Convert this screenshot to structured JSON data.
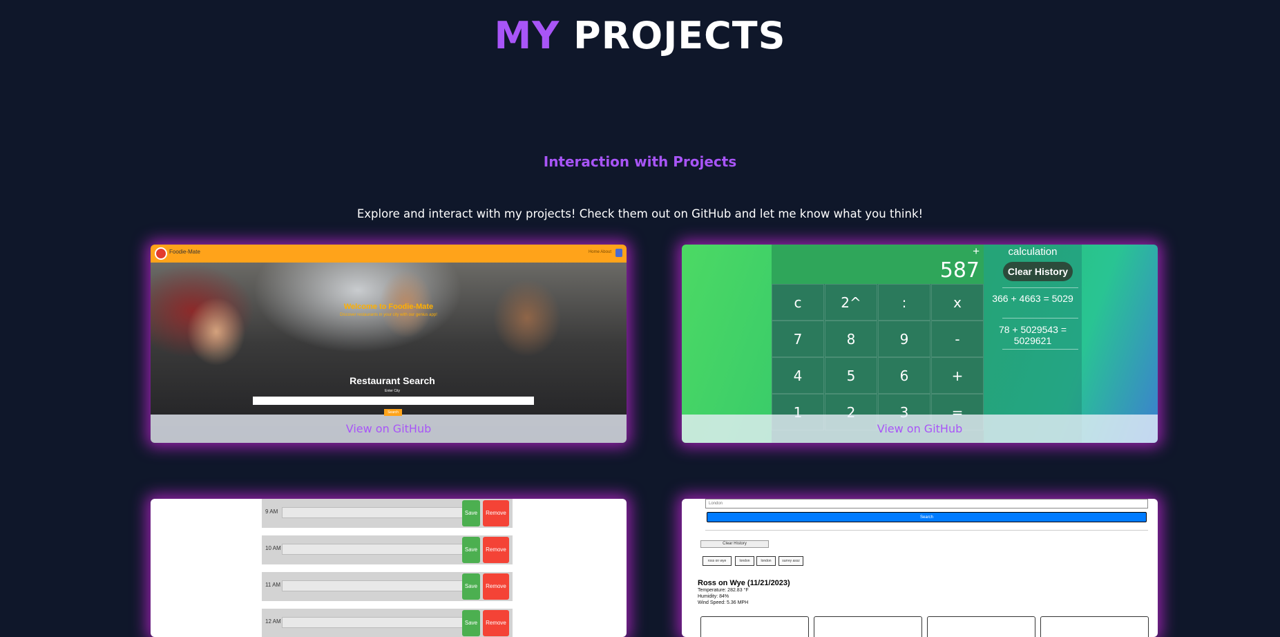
{
  "header": {
    "title_accent": "MY",
    "title_rest": "PROJECTS"
  },
  "section": {
    "subtitle": "Interaction with Projects",
    "description": "Explore and interact with my projects! Check them out on GitHub and let me know what you think!"
  },
  "colors": {
    "background": "#0f172a",
    "accent": "#a855f7",
    "glow": "#c026d3"
  },
  "cards": {
    "foodie": {
      "github_label": "View on GitHub",
      "brand": "Foodie-Mate",
      "nav_links": "Home  About",
      "welcome": "Welcome to Foodie-Mate",
      "tagline": "Discover restaurants in your city with our genius app!",
      "search_title": "Restaurant Search",
      "city_label": "Enter City",
      "search_button": "Search"
    },
    "calculator": {
      "github_label": "View on GitHub",
      "operator": "+",
      "display": "587",
      "keys": [
        "c",
        "2^",
        ":",
        "x",
        "7",
        "8",
        "9",
        "-",
        "4",
        "5",
        "6",
        "+",
        "1",
        "2",
        "3",
        "="
      ],
      "history_title": "calculation",
      "clear_history": "Clear History",
      "history": [
        "366 + 4663 = 5029",
        "78 + 5029543 = 5029621"
      ]
    },
    "scheduler": {
      "rows": [
        {
          "time": "9 AM",
          "save": "Save",
          "remove": "Remove"
        },
        {
          "time": "10 AM",
          "save": "Save",
          "remove": "Remove"
        },
        {
          "time": "11 AM",
          "save": "Save",
          "remove": "Remove"
        },
        {
          "time": "12 AM",
          "save": "Save",
          "remove": "Remove"
        }
      ]
    },
    "weather": {
      "city_input": "London",
      "search_button": "Search",
      "clear_history": "Clear History",
      "history_cities": [
        "ross on wye",
        "london",
        "london",
        "surrey assz"
      ],
      "current": {
        "heading": "Ross on Wye (11/21/2023)",
        "temperature": "Temperature: 282.83 °F",
        "humidity": "Humidity: 84%",
        "wind": "Wind Speed: 5.36 MPH"
      }
    }
  }
}
